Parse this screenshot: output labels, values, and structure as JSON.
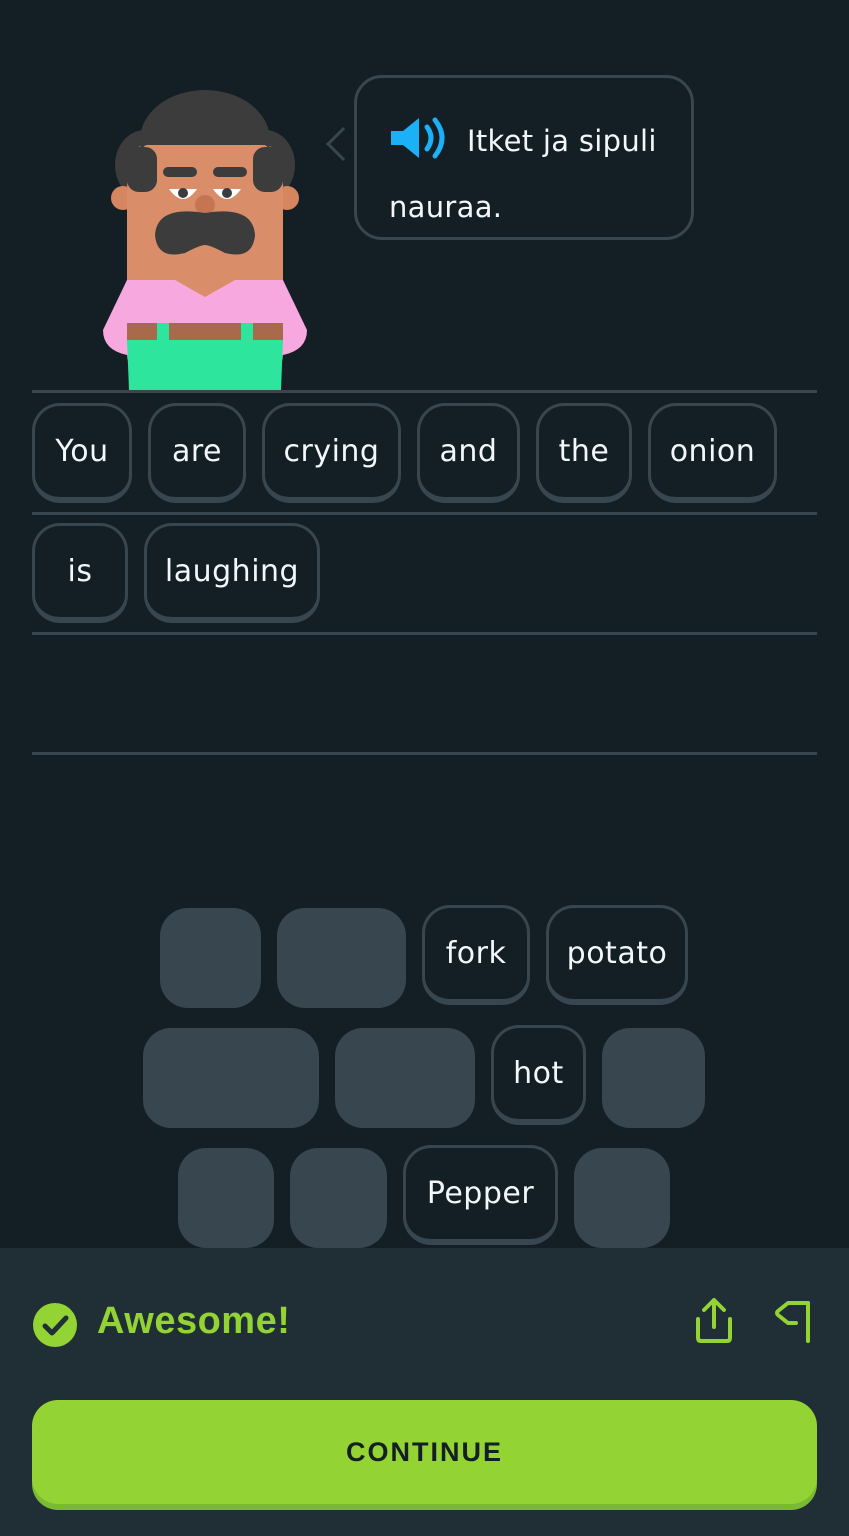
{
  "prompt": {
    "sentence": "Itket ja sipuli nauraa.",
    "speaker_icon": "speaker-icon",
    "accent_color": "#1cb0f6"
  },
  "answer": {
    "words": [
      "You",
      "are",
      "crying",
      "and",
      "the",
      "onion",
      "is",
      "laughing"
    ]
  },
  "word_bank": {
    "visible_words": [
      "fork",
      "potato",
      "hot",
      "Pepper"
    ]
  },
  "feedback": {
    "message": "Awesome!",
    "status_icon": "check-circle-icon",
    "share_icon": "share-icon",
    "report_icon": "flag-icon",
    "success_color": "#93d333"
  },
  "footer": {
    "continue_label": "CONTINUE"
  }
}
